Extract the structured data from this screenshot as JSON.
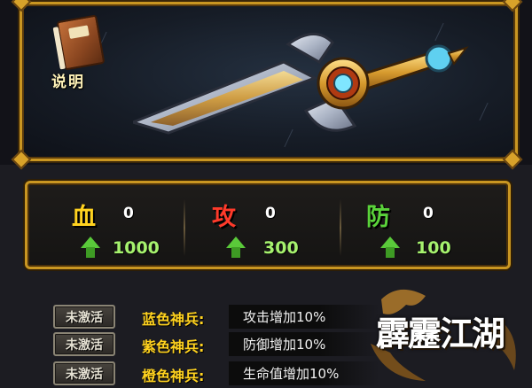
{
  "help": {
    "label": "说明",
    "icon": "book-icon"
  },
  "stats": [
    {
      "name": "血",
      "value": "0",
      "bonus": "1000",
      "color": "#ffd21f"
    },
    {
      "name": "攻",
      "value": "0",
      "bonus": "300",
      "color": "#ff3a2a"
    },
    {
      "name": "防",
      "value": "0",
      "bonus": "100",
      "color": "#5ad33a"
    }
  ],
  "bonuses": [
    {
      "status": "未激活",
      "tier": "蓝色神兵:",
      "tier_color": "#ffd21f",
      "effect": "攻击增加10%"
    },
    {
      "status": "未激活",
      "tier": "紫色神兵:",
      "tier_color": "#ffd21f",
      "effect": "防御增加10%"
    },
    {
      "status": "未激活",
      "tier": "橙色神兵:",
      "tier_color": "#ffd21f",
      "effect": "生命值增加10%"
    }
  ],
  "logo": {
    "text": "霹靂江湖"
  }
}
